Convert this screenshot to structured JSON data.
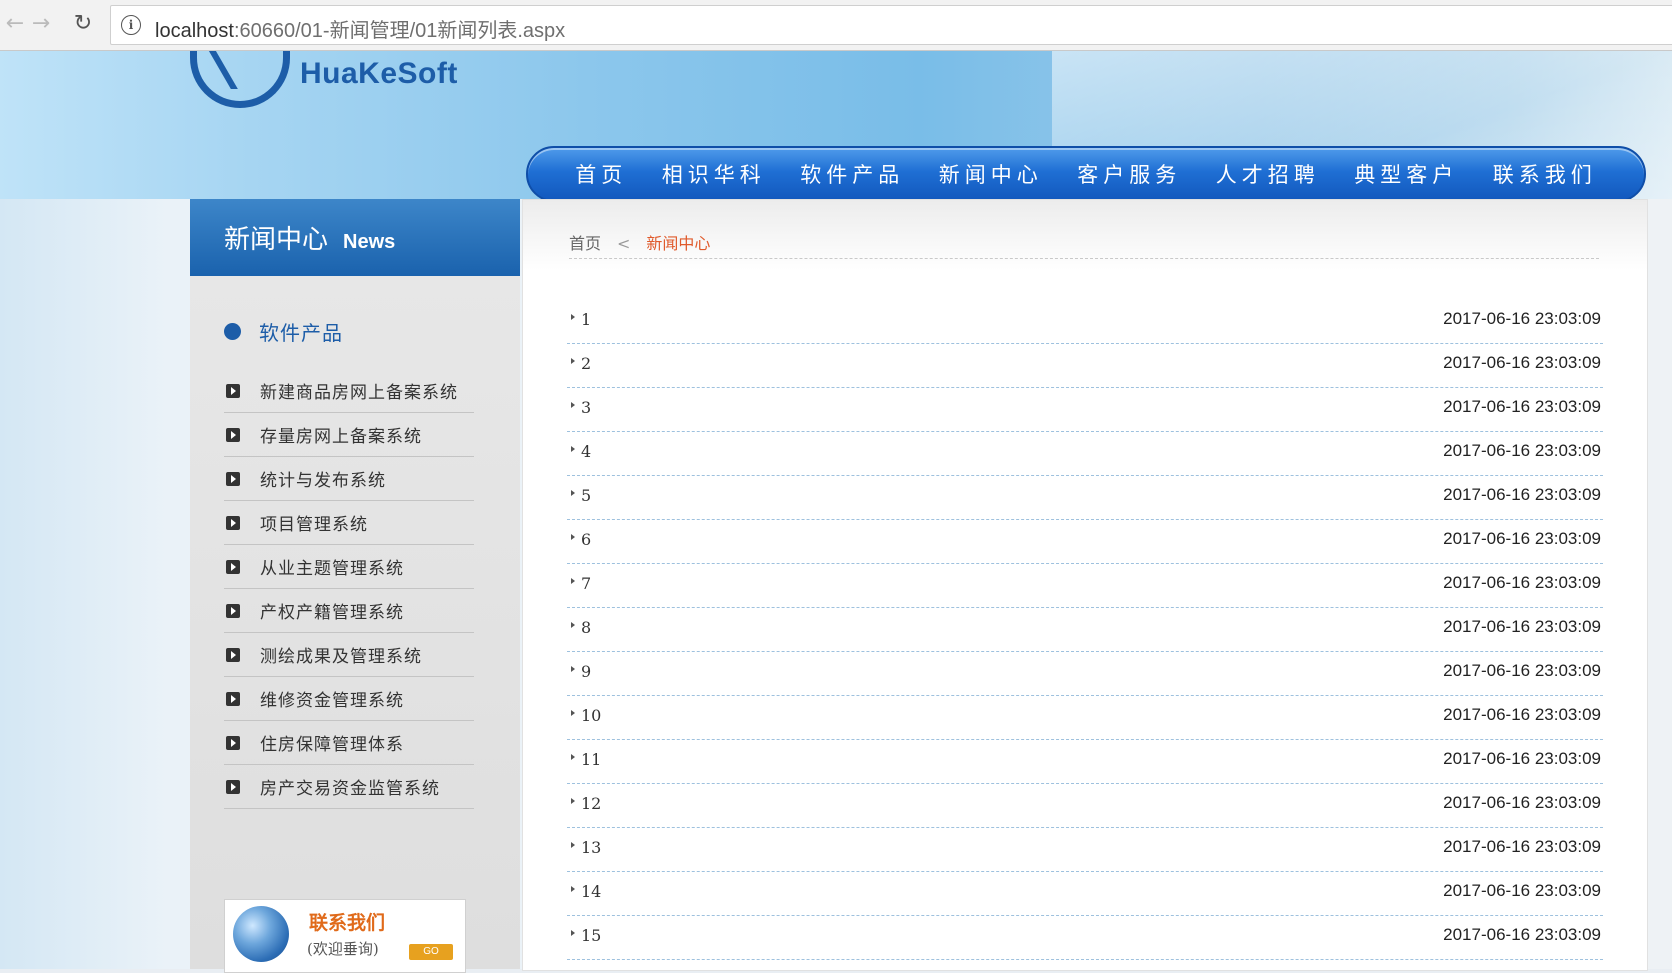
{
  "browser": {
    "url_host": "localhost",
    "url_rest": ":60660/01-新闻管理/01新闻列表.aspx"
  },
  "header": {
    "logo_text": "HuaKeSoft",
    "nav": [
      "首页",
      "相识华科",
      "软件产品",
      "新闻中心",
      "客户服务",
      "人才招聘",
      "典型客户",
      "联系我们"
    ]
  },
  "sidebar": {
    "title_cn": "新闻中心",
    "title_en": "News",
    "category": "软件产品",
    "items": [
      "新建商品房网上备案系统",
      "存量房网上备案系统",
      "统计与发布系统",
      "项目管理系统",
      "从业主题管理系统",
      "产权产籍管理系统",
      "测绘成果及管理系统",
      "维修资金管理系统",
      "住房保障管理体系",
      "房产交易资金监管系统"
    ],
    "contact": {
      "title": "联系我们",
      "subtitle": "(欢迎垂询)",
      "go": "GO"
    }
  },
  "breadcrumb": {
    "home": "首页",
    "separator": "<",
    "current": "新闻中心"
  },
  "news": [
    {
      "title": "1",
      "date": "2017-06-16 23:03:09"
    },
    {
      "title": "2",
      "date": "2017-06-16 23:03:09"
    },
    {
      "title": "3",
      "date": "2017-06-16 23:03:09"
    },
    {
      "title": "4",
      "date": "2017-06-16 23:03:09"
    },
    {
      "title": "5",
      "date": "2017-06-16 23:03:09"
    },
    {
      "title": "6",
      "date": "2017-06-16 23:03:09"
    },
    {
      "title": "7",
      "date": "2017-06-16 23:03:09"
    },
    {
      "title": "8",
      "date": "2017-06-16 23:03:09"
    },
    {
      "title": "9",
      "date": "2017-06-16 23:03:09"
    },
    {
      "title": "10",
      "date": "2017-06-16 23:03:09"
    },
    {
      "title": "11",
      "date": "2017-06-16 23:03:09"
    },
    {
      "title": "12",
      "date": "2017-06-16 23:03:09"
    },
    {
      "title": "13",
      "date": "2017-06-16 23:03:09"
    },
    {
      "title": "14",
      "date": "2017-06-16 23:03:09"
    },
    {
      "title": "15",
      "date": "2017-06-16 23:03:09"
    }
  ]
}
